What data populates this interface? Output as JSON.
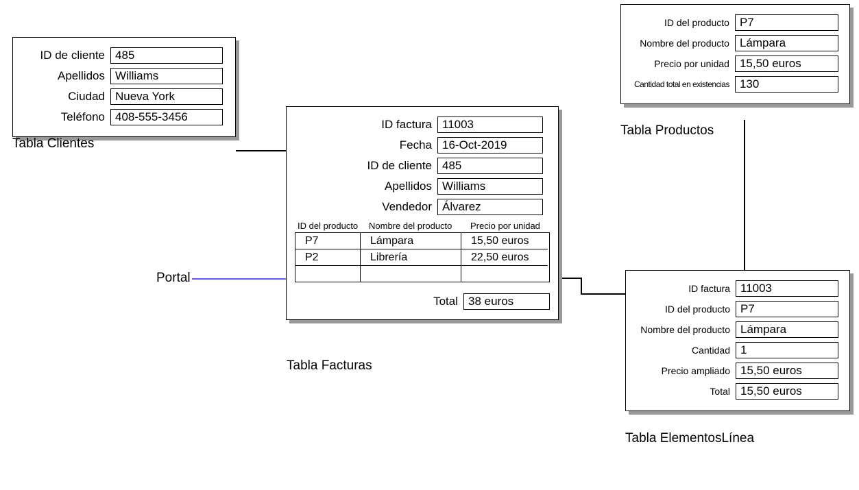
{
  "clientes": {
    "title": "Tabla Clientes",
    "fields": {
      "id_label": "ID de cliente",
      "id_value": "485",
      "apellidos_label": "Apellidos",
      "apellidos_value": "Williams",
      "ciudad_label": "Ciudad",
      "ciudad_value": "Nueva York",
      "telefono_label": "Teléfono",
      "telefono_value": "408-555-3456"
    }
  },
  "productos": {
    "title": "Tabla Productos",
    "fields": {
      "id_label": "ID del producto",
      "id_value": "P7",
      "nombre_label": "Nombre del producto",
      "nombre_value": "Lámpara",
      "precio_label": "Precio por unidad",
      "precio_value": "15,50 euros",
      "stock_label": "Cantidad total en existencias",
      "stock_value": "130"
    }
  },
  "facturas": {
    "title": "Tabla Facturas",
    "fields": {
      "id_label": "ID factura",
      "id_value": "11003",
      "fecha_label": "Fecha",
      "fecha_value": "16-Oct-2019",
      "cliente_label": "ID de cliente",
      "cliente_value": "485",
      "apellidos_label": "Apellidos",
      "apellidos_value": "Williams",
      "vendedor_label": "Vendedor",
      "vendedor_value": "Álvarez"
    },
    "portal": {
      "headers": {
        "col1": "ID del producto",
        "col2": "Nombre del producto",
        "col3": "Precio por unidad"
      },
      "rows": [
        {
          "id": "P7",
          "nombre": "Lámpara",
          "precio": "15,50 euros"
        },
        {
          "id": "P2",
          "nombre": "Librería",
          "precio": "22,50 euros"
        },
        {
          "id": "",
          "nombre": "",
          "precio": ""
        }
      ]
    },
    "total_label": "Total",
    "total_value": "38 euros"
  },
  "elementos": {
    "title": "Tabla ElementosLínea",
    "fields": {
      "factura_label": "ID factura",
      "factura_value": "11003",
      "prod_label": "ID del producto",
      "prod_value": "P7",
      "nombre_label": "Nombre del producto",
      "nombre_value": "Lámpara",
      "cant_label": "Cantidad",
      "cant_value": "1",
      "precio_label": "Precio ampliado",
      "precio_value": "15,50 euros",
      "total_label": "Total",
      "total_value": "15,50 euros"
    }
  },
  "portal_label": "Portal"
}
